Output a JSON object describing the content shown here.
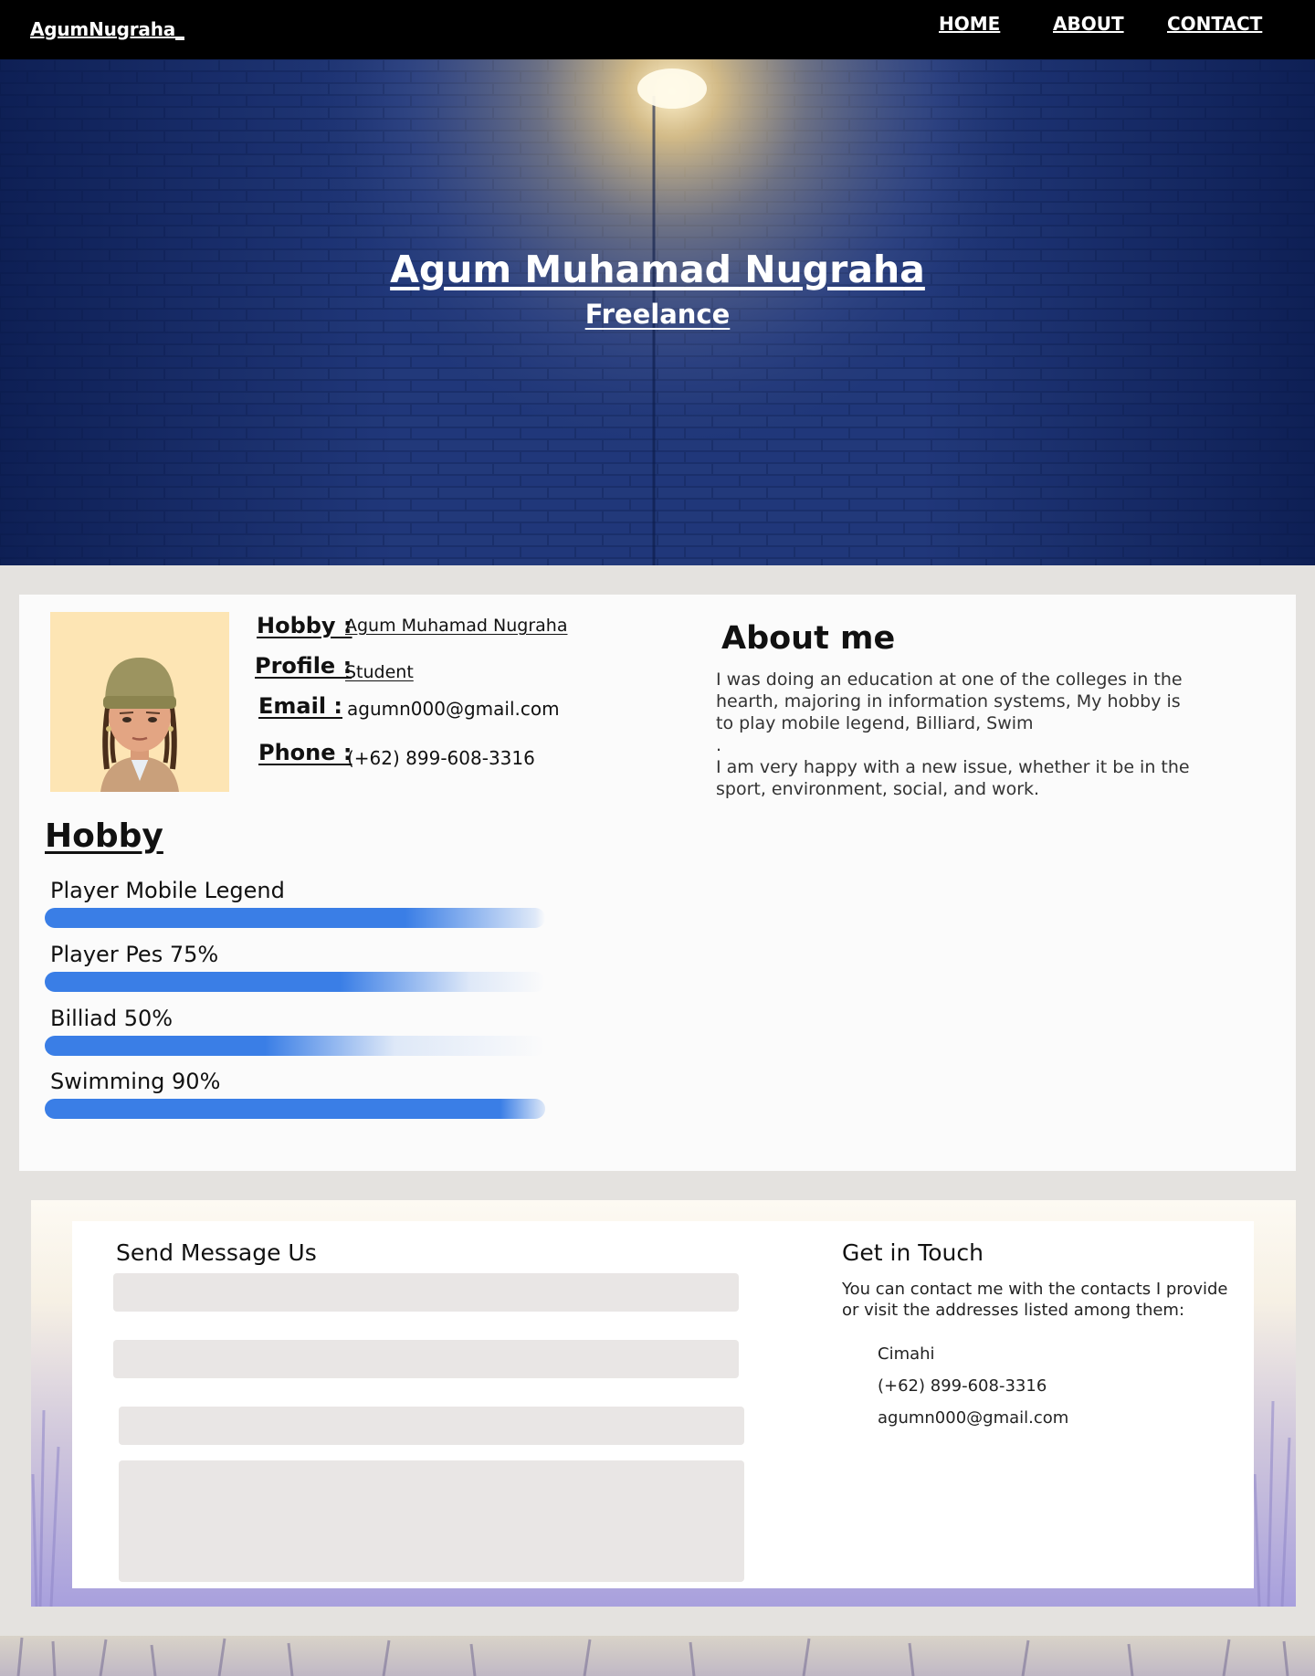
{
  "nav": {
    "brand": "AgumNugraha_",
    "links": [
      "HOME",
      "ABOUT",
      "CONTACT"
    ]
  },
  "hero": {
    "name": "Agum Muhamad Nugraha",
    "role": "Freelance"
  },
  "profile": {
    "hobby_label": "Hobby :",
    "hobby_value": "Agum Muhamad Nugraha",
    "profile_label": "Profile  :",
    "profile_value": "Student",
    "email_label": "Email   :",
    "email_value": "agumn000@gmail.com",
    "phone_label": "Phone :",
    "phone_value": "(+62) 899-608-3316"
  },
  "about": {
    "title": "About me",
    "paragraphs": [
      "I was doing an education at one of the colleges in the hearth, majoring in information systems, My hobby is to play mobile legend, Billiard, Swim",
      ".",
      "I am very happy with a new issue, whether it be in the sport, environment, social, and work."
    ]
  },
  "hobby": {
    "title": "Hobby",
    "items": [
      {
        "label": "Player Mobile Legend",
        "level": 0.78
      },
      {
        "label": "Player Pes 75%",
        "level": 0.65
      },
      {
        "label": "Billiad 50%",
        "level": 0.5
      },
      {
        "label": "Swimming 90%",
        "level": 0.97
      }
    ]
  },
  "contact": {
    "form_title": "Send Message Us",
    "touch_title": "Get in Touch",
    "touch_text": "You can contact me with the contacts I provide or visit the addresses listed among them:",
    "city": "Cimahi",
    "phone": "(+62) 899-608-3316",
    "email": "agumn000@gmail.com"
  },
  "colors": {
    "accent": "#3a7ee6",
    "nav_bg": "#000000",
    "hero_bg": "#0e2459"
  }
}
